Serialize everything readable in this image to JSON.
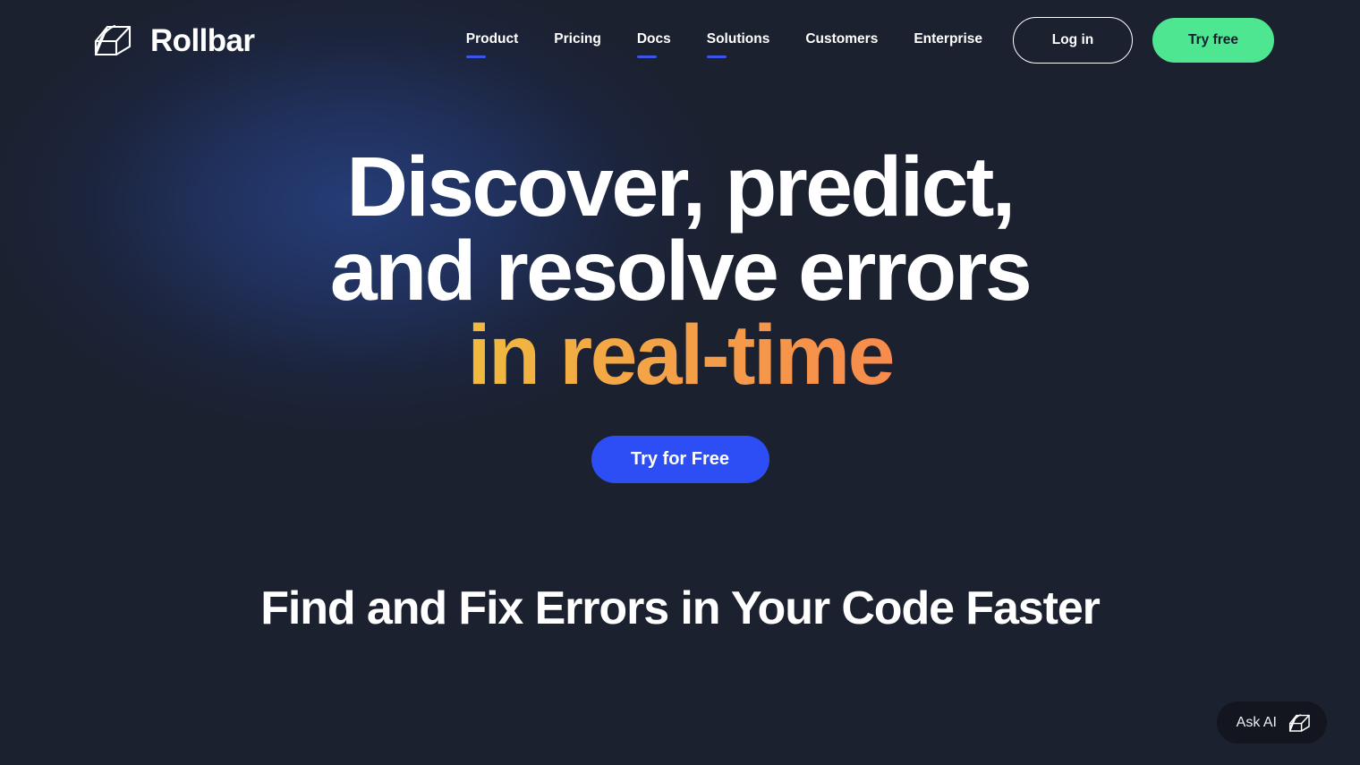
{
  "brand": {
    "name": "Rollbar",
    "logo_icon": "rollbar-cube-icon"
  },
  "nav": {
    "items": [
      {
        "label": "Product",
        "has_dropdown_underline": true
      },
      {
        "label": "Pricing",
        "has_dropdown_underline": false
      },
      {
        "label": "Docs",
        "has_dropdown_underline": true
      },
      {
        "label": "Solutions",
        "has_dropdown_underline": true
      },
      {
        "label": "Customers",
        "has_dropdown_underline": false
      },
      {
        "label": "Enterprise",
        "has_dropdown_underline": false
      }
    ]
  },
  "header_actions": {
    "login_label": "Log in",
    "try_free_label": "Try free"
  },
  "hero": {
    "headline_line1": "Discover, predict,",
    "headline_line2": "and resolve errors",
    "headline_accent": "in real-time",
    "cta_label": "Try for Free"
  },
  "section": {
    "heading": "Find and Fix Errors in Your Code Faster"
  },
  "ask_ai": {
    "label": "Ask AI",
    "icon": "rollbar-cube-icon"
  },
  "colors": {
    "background": "#1c2130",
    "hero_glow": "#263e7c",
    "accent_green": "#4ee691",
    "accent_blue": "#2d4ef5",
    "nav_underline": "#3b55e8",
    "gradient_start": "#e8ed2a",
    "gradient_end": "#f8764f",
    "ask_ai_background": "#13161f"
  }
}
